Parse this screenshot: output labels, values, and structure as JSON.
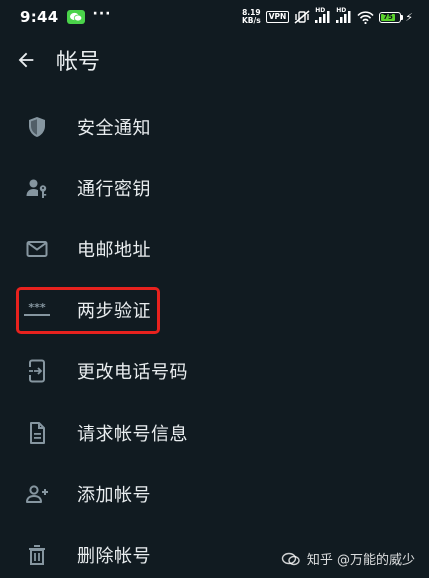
{
  "status_bar": {
    "time": "9:44",
    "more_indicator": "···",
    "net_speed_value": "8.19",
    "net_speed_unit": "KB/s",
    "vpn_label": "VPN",
    "hd_label": "HD",
    "battery_level": "75",
    "battery_color": "#5bd32c",
    "icons": [
      "wechat-icon",
      "vibrate-mute-icon",
      "signal-icon",
      "wifi-icon",
      "battery-icon",
      "charging-icon"
    ]
  },
  "header": {
    "title": "帐号",
    "back_icon": "arrow-left-icon"
  },
  "menu": {
    "items": [
      {
        "label": "安全通知",
        "icon": "shield-icon"
      },
      {
        "label": "通行密钥",
        "icon": "passkey-icon"
      },
      {
        "label": "电邮地址",
        "icon": "mail-icon"
      },
      {
        "label": "两步验证",
        "icon": "password-dots-icon"
      },
      {
        "label": "更改电话号码",
        "icon": "phone-change-icon"
      },
      {
        "label": "请求帐号信息",
        "icon": "document-icon"
      },
      {
        "label": "添加帐号",
        "icon": "person-add-icon"
      },
      {
        "label": "删除帐号",
        "icon": "trash-icon"
      }
    ]
  },
  "highlight_color": "#e8221e",
  "watermark": {
    "text": "知乎 @万能的威少"
  },
  "theme": {
    "background": "#111b21",
    "icon_color": "#8696a0",
    "text_color": "#e9edef"
  }
}
